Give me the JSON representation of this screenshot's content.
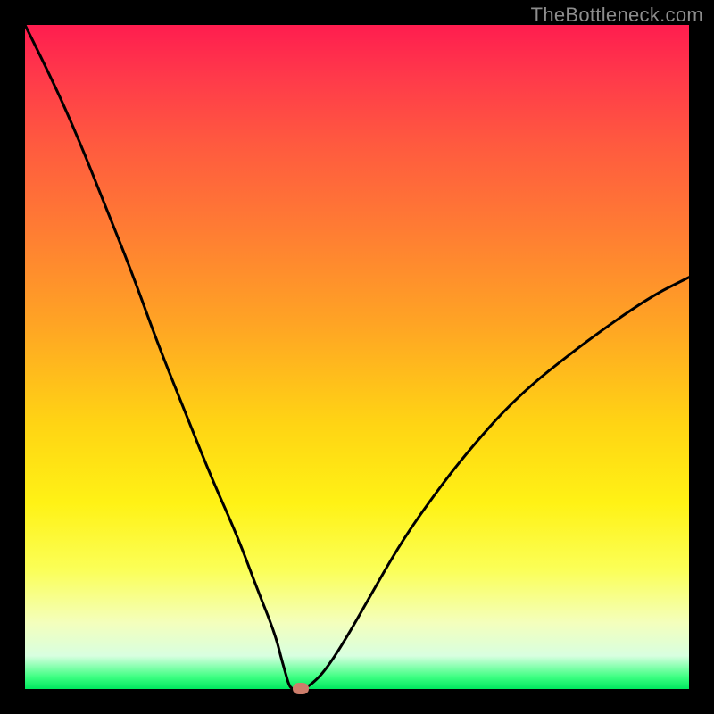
{
  "watermark": "TheBottleneck.com",
  "colors": {
    "marker": "#cd7d6b",
    "curve": "#000000"
  },
  "chart_data": {
    "type": "line",
    "title": "",
    "xlabel": "",
    "ylabel": "",
    "xlim": [
      0,
      100
    ],
    "ylim": [
      0,
      100
    ],
    "series": [
      {
        "name": "bottleneck-curve",
        "x": [
          0,
          4,
          8,
          12,
          16,
          20,
          24,
          28,
          32,
          35,
          37,
          38,
          38.5,
          39,
          39.4,
          39.6,
          39.8,
          40,
          40.2,
          40.5,
          41,
          41.5,
          42,
          43,
          45,
          48,
          52,
          56,
          60,
          66,
          74,
          84,
          94,
          100
        ],
        "y": [
          100,
          92,
          83,
          73,
          63,
          52,
          42,
          32,
          23,
          15,
          10,
          7,
          5,
          3.2,
          1.8,
          1.1,
          0.6,
          0.25,
          0.1,
          0.0,
          0.0,
          0.0,
          0.1,
          0.6,
          2.5,
          7,
          14,
          21,
          27,
          35,
          44,
          52,
          59,
          62
        ]
      }
    ],
    "marker": {
      "x": 41.5,
      "y": 0.0
    },
    "grid": false,
    "legend": false
  }
}
